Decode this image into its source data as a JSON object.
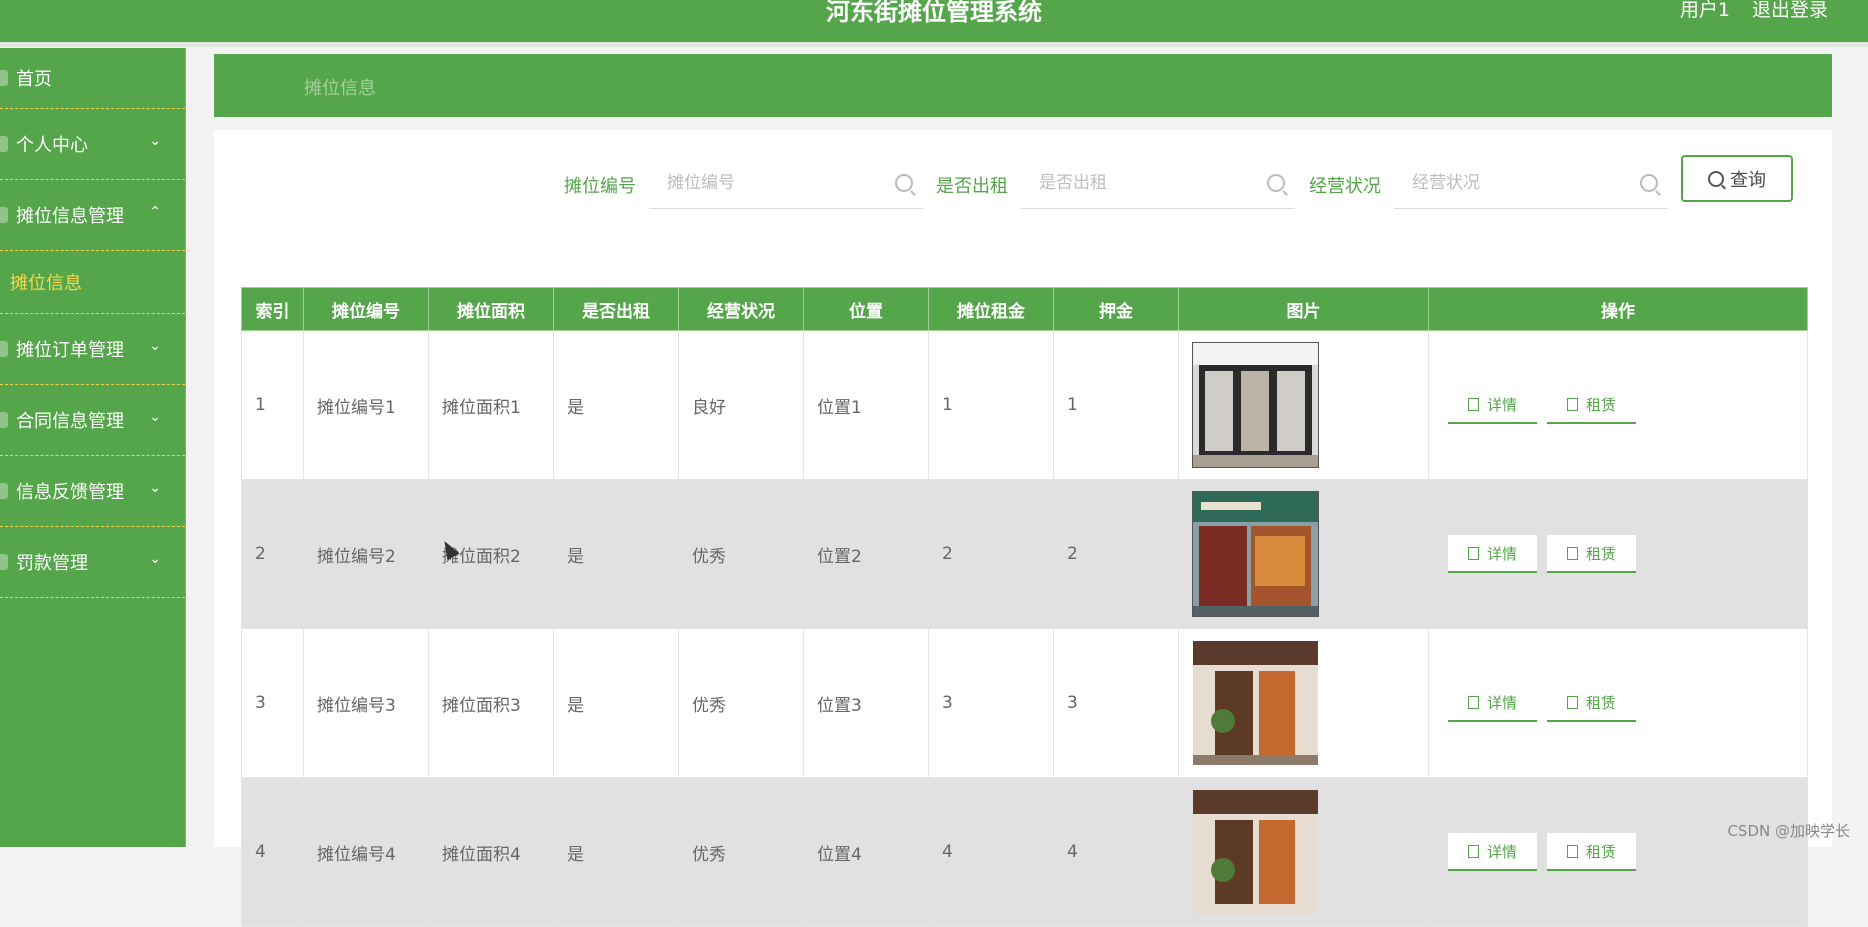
{
  "header": {
    "title": "河东街摊位管理系统",
    "user": "用户1",
    "logout": "退出登录"
  },
  "sidebar": {
    "items": [
      {
        "label": "首页",
        "icon": "home-icon",
        "expanded": false
      },
      {
        "label": "个人中心",
        "icon": "user-icon",
        "expanded": false
      },
      {
        "label": "摊位信息管理",
        "icon": "doc-icon",
        "expanded": true,
        "children": [
          "摊位信息"
        ]
      },
      {
        "label": "摊位订单管理",
        "icon": "order-icon",
        "expanded": false
      },
      {
        "label": "合同信息管理",
        "icon": "contract-icon",
        "expanded": false
      },
      {
        "label": "信息反馈管理",
        "icon": "feedback-icon",
        "expanded": false
      },
      {
        "label": "罚款管理",
        "icon": "fine-icon",
        "expanded": false
      }
    ]
  },
  "banner": {
    "text": "摊位信息"
  },
  "search": {
    "fields": [
      {
        "label": "摊位编号",
        "placeholder": "摊位编号"
      },
      {
        "label": "是否出租",
        "placeholder": "是否出租"
      },
      {
        "label": "经营状况",
        "placeholder": "经营状况"
      }
    ],
    "button": "查询"
  },
  "table": {
    "headers": [
      "索引",
      "摊位编号",
      "摊位面积",
      "是否出租",
      "经营状况",
      "位置",
      "摊位租金",
      "押金",
      "图片",
      "操作"
    ],
    "rows": [
      {
        "idx": "1",
        "code": "摊位编号1",
        "area": "摊位面积1",
        "rented": "是",
        "status": "良好",
        "loc": "位置1",
        "rent": "1",
        "deposit": "1"
      },
      {
        "idx": "2",
        "code": "摊位编号2",
        "area": "摊位面积2",
        "rented": "是",
        "status": "优秀",
        "loc": "位置2",
        "rent": "2",
        "deposit": "2"
      },
      {
        "idx": "3",
        "code": "摊位编号3",
        "area": "摊位面积3",
        "rented": "是",
        "status": "优秀",
        "loc": "位置3",
        "rent": "3",
        "deposit": "3"
      },
      {
        "idx": "4",
        "code": "摊位编号4",
        "area": "摊位面积4",
        "rented": "是",
        "status": "优秀",
        "loc": "位置4",
        "rent": "4",
        "deposit": "4"
      }
    ],
    "ops": {
      "detail": "详情",
      "lease": "租赁"
    }
  },
  "watermark": "CSDN @加映学长",
  "colors": {
    "primary": "#55a54b",
    "accent": "#f7d84b"
  }
}
